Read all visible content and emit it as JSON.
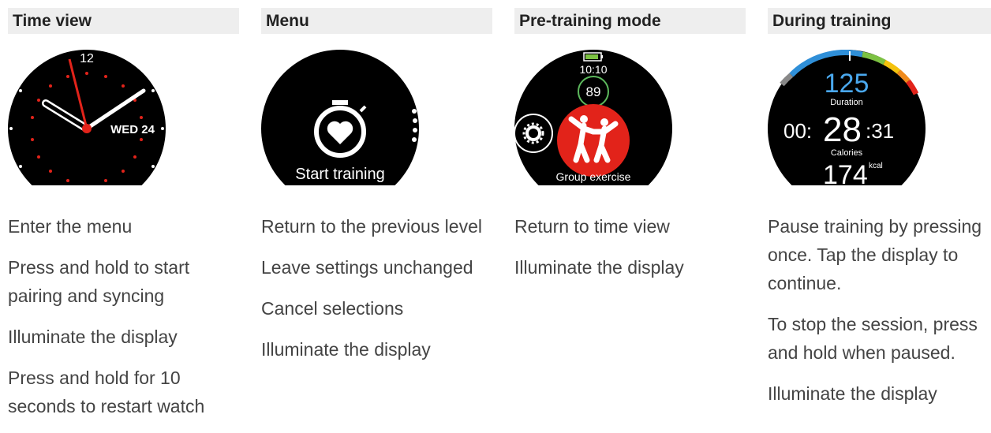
{
  "columns": [
    {
      "header": "Time view",
      "watch": {
        "hour": "12",
        "date": "WED 24"
      },
      "items": [
        "Enter the menu",
        "Press and hold to start pairing and syncing",
        "Illuminate the display",
        "Press and hold for 10 seconds to restart watch"
      ]
    },
    {
      "header": "Menu",
      "watch": {
        "label": "Start training",
        "icon": "stopwatch-heart-icon"
      },
      "items": [
        "Return to the previous level",
        "Leave settings unchanged",
        "Cancel selections",
        "Illuminate the display"
      ]
    },
    {
      "header": "Pre-training mode",
      "watch": {
        "time": "10:10",
        "heart_rate": "89",
        "sport": "Group exercise",
        "icon": "group-exercise-icon"
      },
      "items": [
        "Return to time view",
        "Illuminate the display"
      ]
    },
    {
      "header": "During training",
      "watch": {
        "heart_rate": "125",
        "duration_label": "Duration",
        "duration_prefix": "00:",
        "duration_big": "28",
        "duration_suffix": ":31",
        "calories_label": "Calories",
        "calories_value": "174",
        "calories_unit": "kcal"
      },
      "items": [
        "Pause training by pressing once. Tap the display to continue.",
        "To stop the session, press and hold when paused.",
        "Illuminate the display"
      ]
    }
  ],
  "colors": {
    "header_bg": "#eeeeee",
    "watch_face": "#000000",
    "accent_red": "#e2231a",
    "hr_zone_blue": "#2f8fd8",
    "hr_zone_green": "#7cc142",
    "hr_zone_yellow": "#f4c20d",
    "hr_zone_orange": "#f08a1c",
    "hr_ring_green": "#5cb85c"
  }
}
